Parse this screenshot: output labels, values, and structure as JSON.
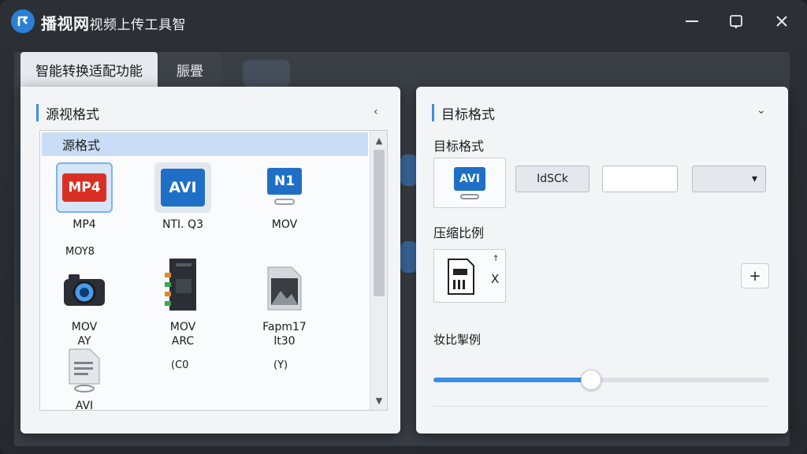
{
  "app": {
    "title_main": "播视网",
    "title_sub": "视频上传工具智",
    "window_buttons": {
      "minimize": "minimize-icon",
      "maximize": "maximize-icon",
      "close": "close-icon"
    }
  },
  "tabs": [
    {
      "label": "智能转换适配功能",
      "active": true
    },
    {
      "label": "脤舋",
      "active": false
    }
  ],
  "source_panel": {
    "title": "源视格式",
    "collapse_glyph": "‹",
    "list_header": "源格式",
    "tiles": [
      {
        "badge": "MP4",
        "label": "MP4",
        "label2": "",
        "selected": true,
        "icon": "mp4-icon"
      },
      {
        "badge": "AVI",
        "label": "NTI. Q3",
        "label2": "",
        "selected": false,
        "icon": "avi-icon"
      },
      {
        "badge": "N1",
        "label": "MOV",
        "label2": "",
        "selected": false,
        "icon": "mov-icon"
      },
      {
        "badge": "",
        "label": "MOV",
        "label2": "AY",
        "selected": false,
        "icon": "camera-icon"
      },
      {
        "badge": "",
        "label": "MOV",
        "label2": "ARC",
        "selected": false,
        "icon": "film-strip-icon"
      },
      {
        "badge": "",
        "label": "Fapm17",
        "label2": "lt30",
        "selected": false,
        "icon": "image-file-icon"
      },
      {
        "badge": "",
        "label": "AVI",
        "label2": "",
        "selected": false,
        "icon": "document-icon"
      }
    ],
    "loose_labels": [
      "MOY8",
      "(C0",
      "(Y)"
    ],
    "scroll_up": "▲",
    "scroll_down": "▼"
  },
  "target_panel": {
    "title": "目标格式",
    "collapse_glyph": "⌄",
    "format_label": "目标格式",
    "format_badge": "AVI",
    "field_text": "IdSCk",
    "field_empty": "",
    "dropdown_glyph": "▾",
    "compress_label": "压缩比例",
    "compress_glyph_top": "↑",
    "compress_glyph_x": "X",
    "plus_glyph": "+",
    "slider_label": "妆比掣例",
    "slider_value": 0.47
  },
  "colors": {
    "accent": "#3b8ee8",
    "mp4_red": "#d93025",
    "avi_blue": "#1f6fc7",
    "title_bar": "#2c3036"
  }
}
